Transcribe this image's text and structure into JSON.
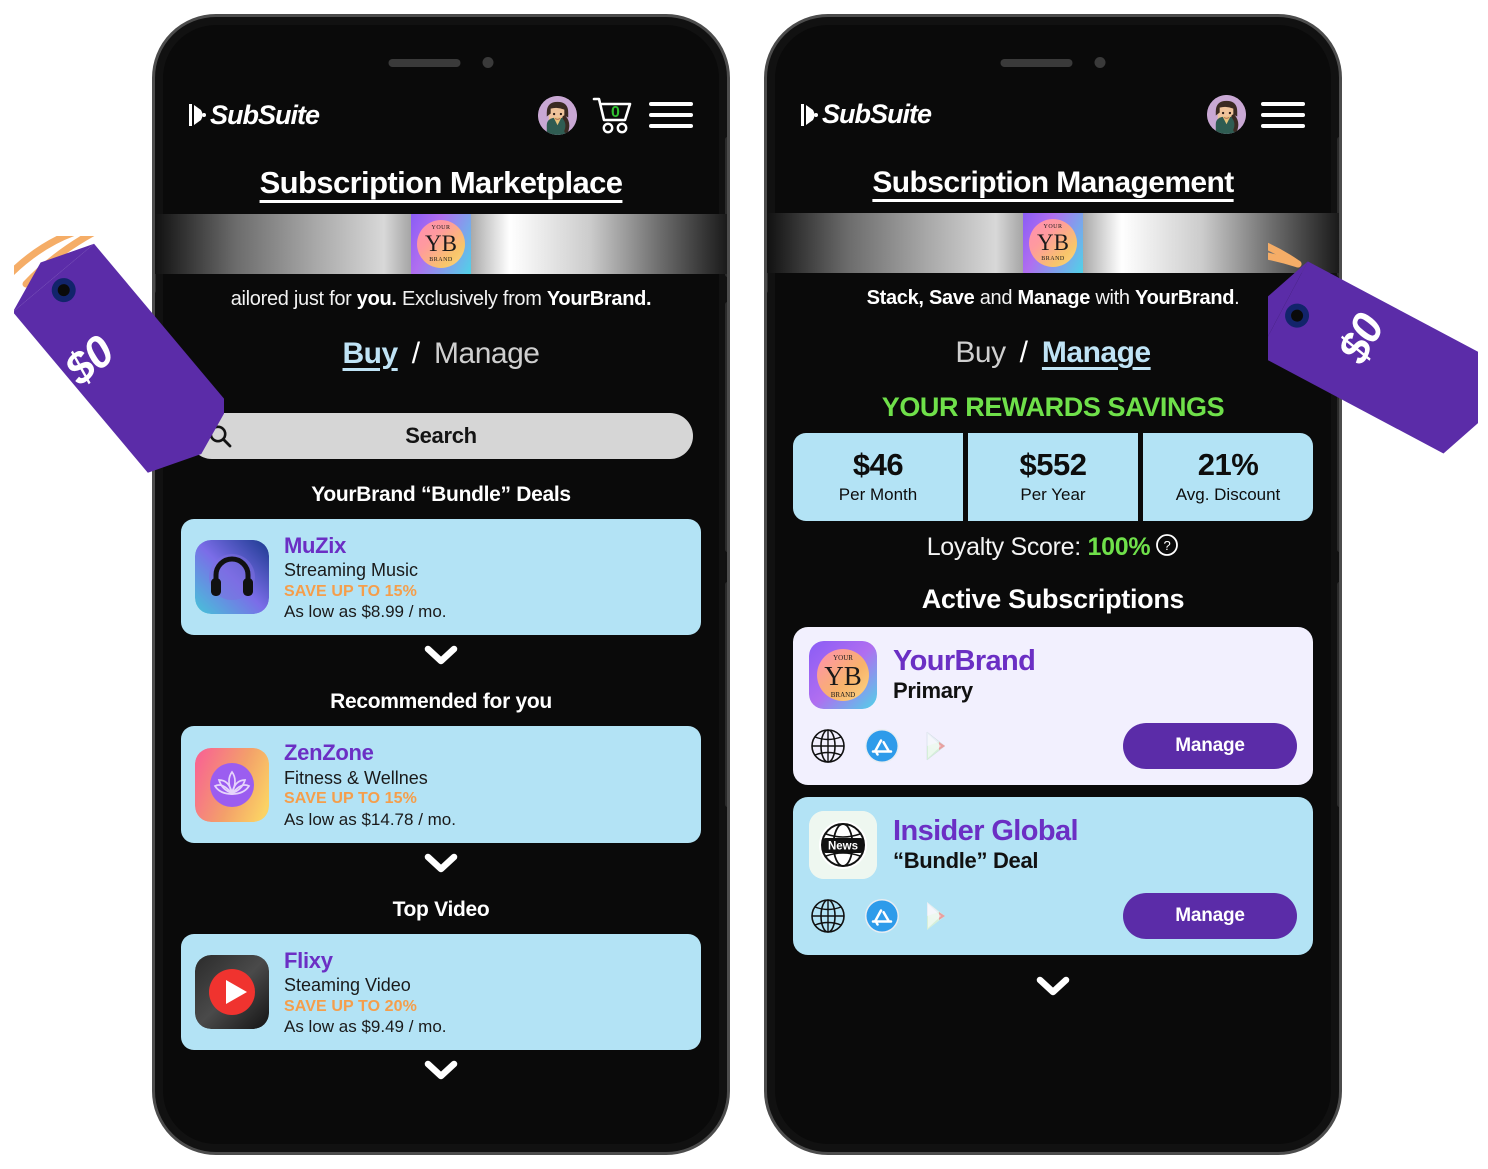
{
  "left_phone": {
    "header": {
      "brand": "SubSuite",
      "brand_mark_icon": "subsuite-logo-mark",
      "avatar_icon": "user-avatar",
      "cart_icon": "shopping-cart-icon",
      "cart_count": "0",
      "menu_icon": "hamburger-menu-icon"
    },
    "page_title": "Subscription Marketplace",
    "banner": {
      "logo_top": "YOUR",
      "logo_mono": "YB",
      "logo_bottom": "BRAND"
    },
    "tagline_prefix": "ailored just for ",
    "tagline_bold_1": "you.",
    "tagline_mid": " Exclusively from ",
    "tagline_bold_2": "YourBrand.",
    "toggle": {
      "buy": "Buy",
      "separator": "/",
      "manage": "Manage",
      "active": "Buy"
    },
    "search": {
      "placeholder": "Search",
      "label": "Search",
      "icon": "search-icon"
    },
    "sections": [
      {
        "title": "YourBrand “Bundle” Deals",
        "card": {
          "name": "MuZix",
          "category": "Streaming Music",
          "save": "SAVE UP TO 15%",
          "price": "As low as $8.99 / mo.",
          "icon": "headphones-icon"
        }
      },
      {
        "title": "Recommended for you",
        "card": {
          "name": "ZenZone",
          "category": "Fitness & Wellnes",
          "save": "SAVE UP TO 15%",
          "price": "As low as $14.78 / mo.",
          "icon": "lotus-icon"
        }
      },
      {
        "title": "Top Video",
        "card": {
          "name": "Flixy",
          "category": "Steaming Video",
          "save": "SAVE UP TO 20%",
          "price": "As low as $9.49 / mo.",
          "icon": "play-button-icon"
        }
      }
    ],
    "scroll_chevron_icon": "chevron-down-icon"
  },
  "right_phone": {
    "header": {
      "brand": "SubSuite",
      "brand_mark_icon": "subsuite-logo-mark",
      "avatar_icon": "user-avatar",
      "menu_icon": "hamburger-menu-icon"
    },
    "page_title": "Subscription Management",
    "banner": {
      "logo_top": "YOUR",
      "logo_mono": "YB",
      "logo_bottom": "BRAND"
    },
    "tagline_bold_1": "Stack, Save",
    "tagline_mid": " and ",
    "tagline_bold_2": "Manage",
    "tagline_mid_2": " with ",
    "tagline_bold_3": "YourBrand",
    "tagline_end": ".",
    "toggle": {
      "buy": "Buy",
      "separator": "/",
      "manage": "Manage",
      "active": "Manage"
    },
    "rewards": {
      "title": "YOUR REWARDS SAVINGS",
      "stats": [
        {
          "value": "$46",
          "label": "Per Month"
        },
        {
          "value": "$552",
          "label": "Per Year"
        },
        {
          "value": "21%",
          "label": "Avg. Discount"
        }
      ],
      "loyalty_label": "Loyalty Score: ",
      "loyalty_value": "100%",
      "help_icon": "question-mark-circle-icon"
    },
    "active_subscriptions": {
      "title": "Active Subscriptions",
      "items": [
        {
          "name": "YourBrand",
          "subtitle": "Primary",
          "logo_icon": "yourbrand-logo",
          "store_icons": [
            "globe-icon",
            "app-store-icon",
            "google-play-icon"
          ],
          "button_label": "Manage"
        },
        {
          "name": "Insider Global",
          "subtitle": "“Bundle” Deal",
          "logo_icon": "news-globe-icon",
          "store_icons": [
            "globe-icon",
            "app-store-icon",
            "google-play-icon"
          ],
          "button_label": "Manage"
        }
      ]
    },
    "scroll_chevron_icon": "chevron-down-icon"
  },
  "price_tags": [
    {
      "text": "$0",
      "color": "#5b2ca8",
      "string_color": "#f5ad67",
      "eyelet_color": "#12246b"
    },
    {
      "text": "$0",
      "color": "#5b2ca8",
      "string_color": "#f5ad67",
      "eyelet_color": "#12246b"
    }
  ],
  "colors": {
    "screen_bg": "#000000",
    "card_blue": "#b3e3f5",
    "card_lavender": "#f2f0fe",
    "accent_purple": "#6b2fc4",
    "button_purple": "#5b2ca8",
    "accent_green": "#6fe04a",
    "accent_orange": "#f59e4b",
    "toggle_active": "#bfe3f5",
    "tag_purple": "#5b2ca8"
  }
}
